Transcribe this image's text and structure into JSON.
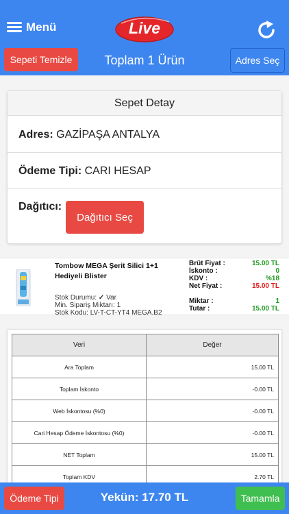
{
  "header": {
    "menu_label": "Menü",
    "logo_text": "Live",
    "refresh_icon": "refresh-icon",
    "colors": {
      "bar": "#3e86ef",
      "logo_red": "#e4262b"
    }
  },
  "subbar": {
    "clear_label": "Sepeti Temizle",
    "title": "Toplam 1 Ürün",
    "address_label": "Adres Seç"
  },
  "detail": {
    "heading": "Sepet Detay",
    "address_key": "Adres:",
    "address_value": "GAZİPAŞA ANTALYA",
    "payment_key": "Ödeme Tipi:",
    "payment_value": "CARI HESAP",
    "distributor_key": "Dağıtıcı:",
    "distributor_button": "Dağıtıcı Seç"
  },
  "product": {
    "name": "Tombow MEGA Şerit Silici 1+1 Hediyeli Blister",
    "stock_label": "Stok Durumu:",
    "stock_value": "Var",
    "min_order": "Min. Sipariş Miktarı: 1",
    "stock_code": "Stok Kodu: LV-T-CT-YT4 MEGA.B2",
    "gross_label": "Brüt Fiyat :",
    "gross_value": "15.00 TL",
    "discount_label": "İskonto :",
    "discount_value": "0",
    "vat_label": "KDV :",
    "vat_value": "%18",
    "net_label": "Net Fiyat :",
    "net_value": "15.00 TL",
    "qty_label": "Miktar :",
    "qty_value": "1",
    "sum_label": "Tutar :",
    "sum_value": "15.00 TL"
  },
  "summary": {
    "headers": [
      "Veri",
      "Değer"
    ],
    "rows": [
      {
        "key": "Ara Toplam",
        "value": "15.00 TL"
      },
      {
        "key": "Toplam İskonto",
        "value": "-0.00 TL"
      },
      {
        "key": "Web İskontosu (%0)",
        "value": "-0.00 TL"
      },
      {
        "key": "Cari Hesap Ödeme İskontosu (%0)",
        "value": "-0.00 TL"
      },
      {
        "key": "NET Toplam",
        "value": "15.00 TL"
      },
      {
        "key": "Toplam KDV",
        "value": "2.70 TL"
      }
    ]
  },
  "footer": {
    "payment_button": "Ödeme Tipi",
    "total": "Yekün: 17.70 TL",
    "done_button": "Tamamla"
  }
}
